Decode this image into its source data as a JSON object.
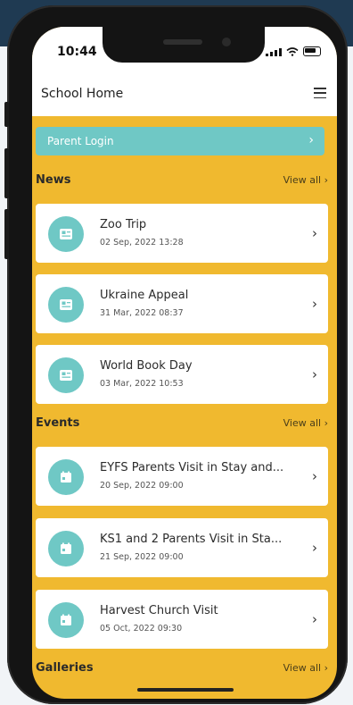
{
  "status": {
    "time": "10:44"
  },
  "header": {
    "title": "School Home"
  },
  "parent_login": {
    "label": "Parent Login",
    "chevron": "›"
  },
  "news": {
    "title": "News",
    "view_all": "View all ›",
    "items": [
      {
        "title": "Zoo Trip",
        "date": "02 Sep, 2022 13:28"
      },
      {
        "title": "Ukraine Appeal",
        "date": "31 Mar, 2022 08:37"
      },
      {
        "title": "World Book Day",
        "date": "03 Mar, 2022 10:53"
      }
    ]
  },
  "events": {
    "title": "Events",
    "view_all": "View all ›",
    "items": [
      {
        "title": "EYFS Parents Visit in Stay and...",
        "date": "20 Sep, 2022 09:00"
      },
      {
        "title": "KS1 and 2 Parents Visit in Sta...",
        "date": "21 Sep, 2022 09:00"
      },
      {
        "title": "Harvest Church Visit",
        "date": "05 Oct, 2022 09:30"
      }
    ]
  },
  "galleries": {
    "title": "Galleries",
    "view_all": "View all ›"
  },
  "colors": {
    "accent_teal": "#6fc8c5",
    "background_yellow": "#f0b92f"
  },
  "icons": {
    "news": "newspaper-icon",
    "events": "calendar-icon",
    "menu": "hamburger-menu-icon"
  }
}
